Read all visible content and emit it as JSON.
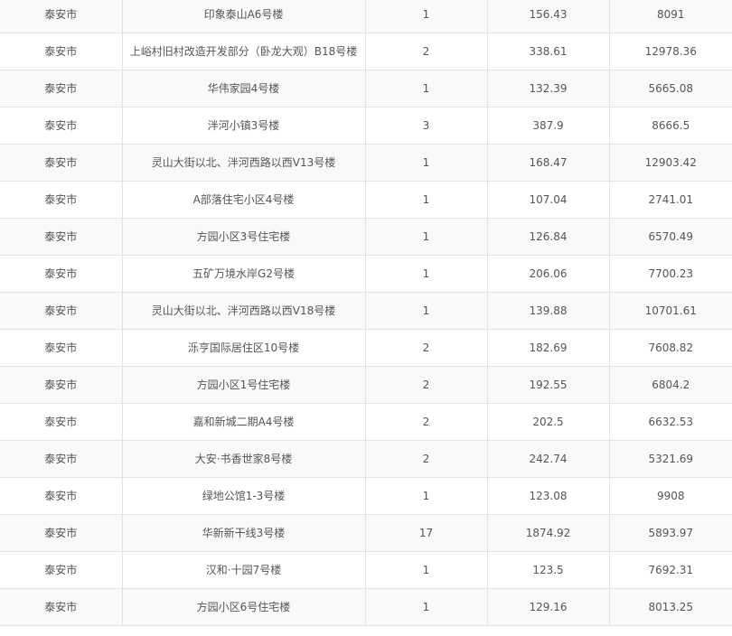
{
  "table": {
    "rows": [
      [
        "泰安市",
        "印象泰山A6号楼",
        "1",
        "156.43",
        "8091"
      ],
      [
        "泰安市",
        "上峪村旧村改造开发部分（卧龙大观）B18号楼",
        "2",
        "338.61",
        "12978.36"
      ],
      [
        "泰安市",
        "华伟家园4号楼",
        "1",
        "132.39",
        "5665.08"
      ],
      [
        "泰安市",
        "泮河小镇3号楼",
        "3",
        "387.9",
        "8666.5"
      ],
      [
        "泰安市",
        "灵山大街以北、泮河西路以西V13号楼",
        "1",
        "168.47",
        "12903.42"
      ],
      [
        "泰安市",
        "A部落住宅小区4号楼",
        "1",
        "107.04",
        "2741.01"
      ],
      [
        "泰安市",
        "方园小区3号住宅楼",
        "1",
        "126.84",
        "6570.49"
      ],
      [
        "泰安市",
        "五矿万境水岸G2号楼",
        "1",
        "206.06",
        "7700.23"
      ],
      [
        "泰安市",
        "灵山大街以北、泮河西路以西V18号楼",
        "1",
        "139.88",
        "10701.61"
      ],
      [
        "泰安市",
        "泺亨国际居住区10号楼",
        "2",
        "182.69",
        "7608.82"
      ],
      [
        "泰安市",
        "方园小区1号住宅楼",
        "2",
        "192.55",
        "6804.2"
      ],
      [
        "泰安市",
        "嘉和新城二期A4号楼",
        "2",
        "202.5",
        "6632.53"
      ],
      [
        "泰安市",
        "大安·书香世家8号楼",
        "2",
        "242.74",
        "5321.69"
      ],
      [
        "泰安市",
        "绿地公馆1-3号楼",
        "1",
        "123.08",
        "9908"
      ],
      [
        "泰安市",
        "华新新干线3号楼",
        "17",
        "1874.92",
        "5893.97"
      ],
      [
        "泰安市",
        "汉和·十园7号楼",
        "1",
        "123.5",
        "7692.31"
      ],
      [
        "泰安市",
        "方园小区6号住宅楼",
        "1",
        "129.16",
        "8013.25"
      ]
    ]
  }
}
